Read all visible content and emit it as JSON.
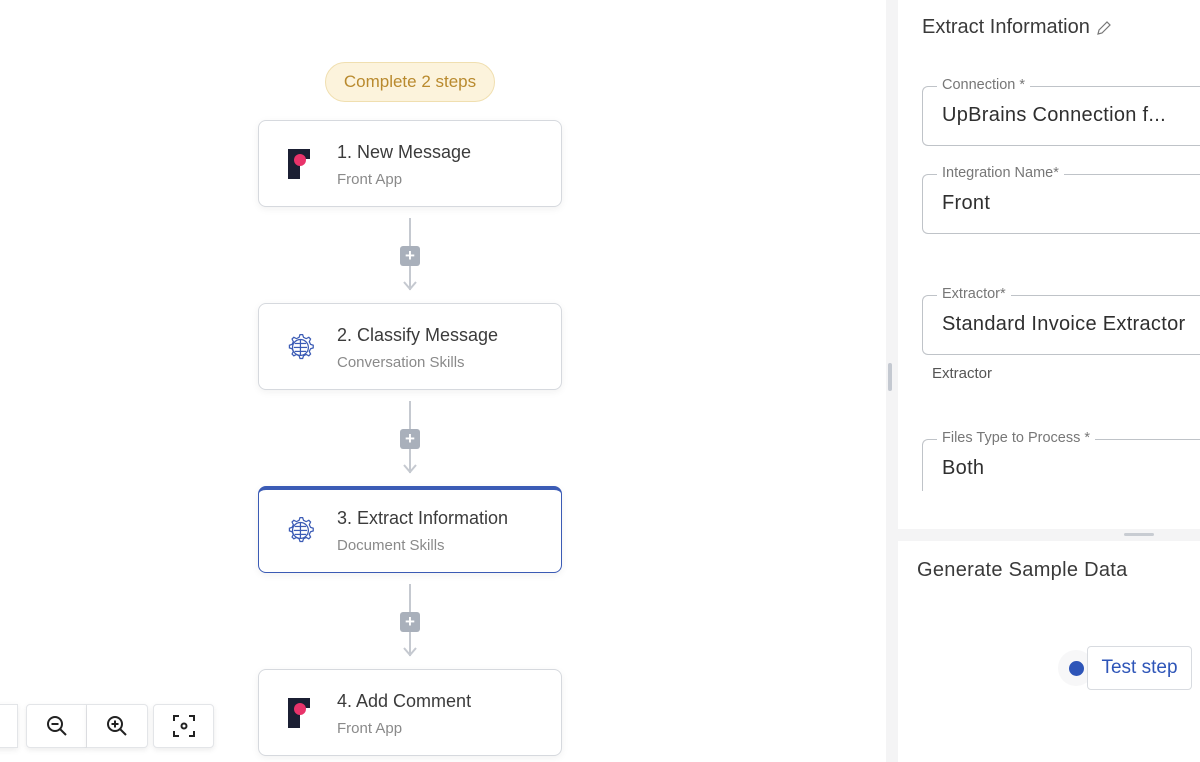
{
  "flow": {
    "status_badge": "Complete 2 steps",
    "steps": [
      {
        "title": "1. New Message",
        "subtitle": "Front App",
        "icon": "front-app-icon"
      },
      {
        "title": "2. Classify Message",
        "subtitle": "Conversation Skills",
        "icon": "brain-gear-icon"
      },
      {
        "title": "3. Extract Information",
        "subtitle": "Document Skills",
        "icon": "brain-gear-icon",
        "selected": true
      },
      {
        "title": "4. Add Comment",
        "subtitle": "Front App",
        "icon": "front-app-icon"
      }
    ],
    "add_step_label": "+"
  },
  "zoom_controls": {
    "zoom_out": "zoom-out-icon",
    "zoom_in": "zoom-in-icon",
    "fit": "fit-view-icon"
  },
  "panel": {
    "title": "Extract Information",
    "fields": [
      {
        "label": "Connection *",
        "value": "UpBrains Connection f..."
      },
      {
        "label": "Integration Name*",
        "value": "Front"
      },
      {
        "label": "Extractor*",
        "value": "Standard Invoice Extractor",
        "helper": "Extractor"
      },
      {
        "label": "Files Type to Process *",
        "value": "Both"
      }
    ]
  },
  "sample_data": {
    "title": "Generate Sample Data",
    "test_button": "Test step"
  },
  "colors": {
    "accent": "#2e55b8",
    "badge_bg": "#fcf3dc",
    "badge_text": "#b98a2e",
    "front_brand": "#e8336a",
    "front_dark": "#1b1f33"
  }
}
